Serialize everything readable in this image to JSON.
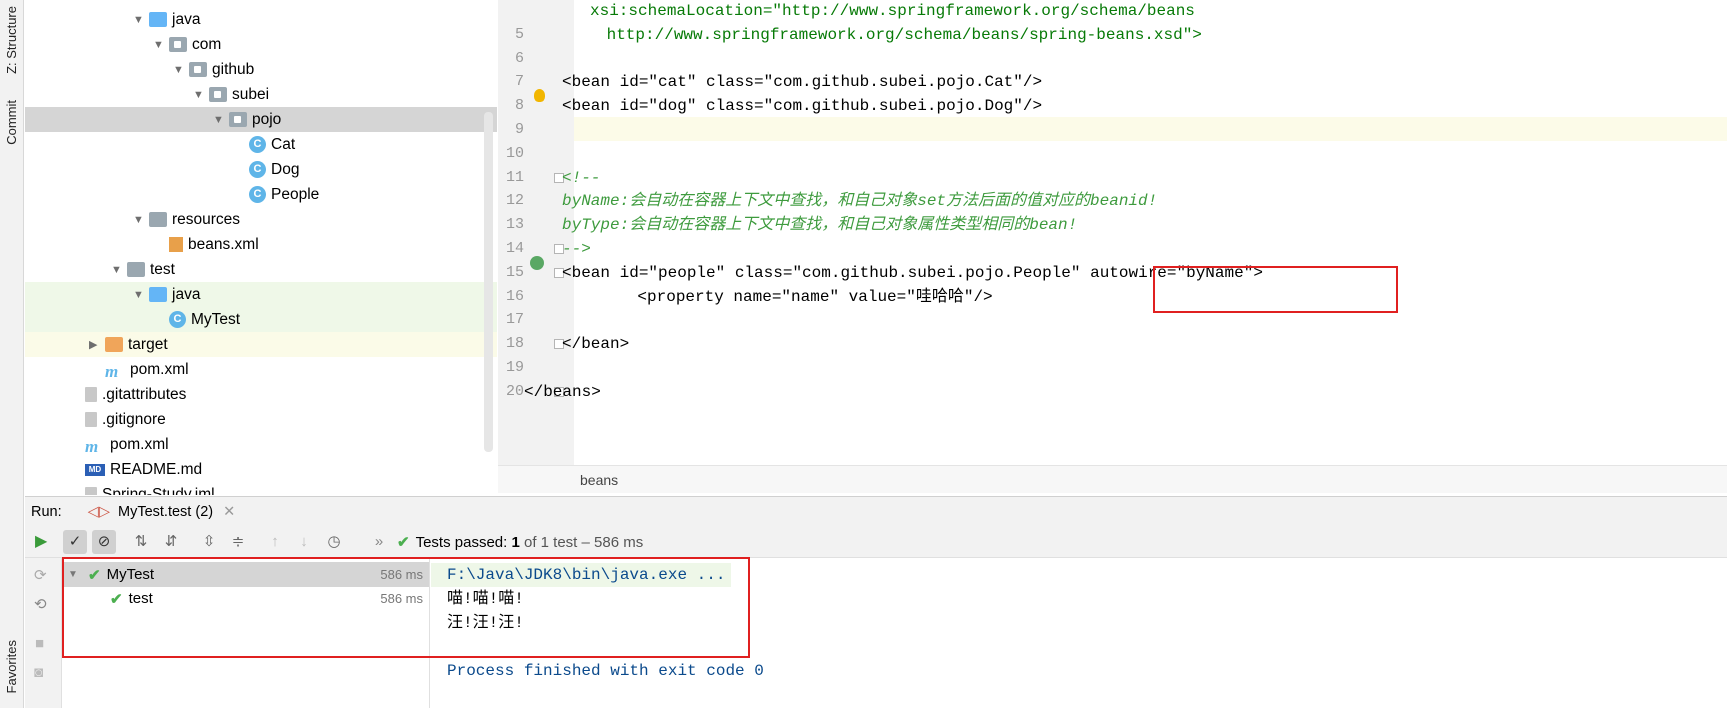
{
  "sidebar_tabs": {
    "structure": "Z: Structure",
    "commit": "Commit",
    "favorites": "Favorites"
  },
  "project_tree": [
    {
      "label": "java",
      "icon": "folder-icon",
      "arrow": "▼"
    },
    {
      "label": "com",
      "icon": "package-icon",
      "arrow": "▼"
    },
    {
      "label": "github",
      "icon": "package-icon",
      "arrow": "▼"
    },
    {
      "label": "subei",
      "icon": "package-icon",
      "arrow": "▼"
    },
    {
      "label": "pojo",
      "icon": "package-icon",
      "arrow": "▼"
    },
    {
      "label": "Cat",
      "icon": "class-icon",
      "arrow": ""
    },
    {
      "label": "Dog",
      "icon": "class-icon",
      "arrow": ""
    },
    {
      "label": "People",
      "icon": "class-icon",
      "arrow": ""
    },
    {
      "label": "resources",
      "icon": "resources-folder-icon",
      "arrow": "▼"
    },
    {
      "label": "beans.xml",
      "icon": "xml-file-icon",
      "arrow": ""
    },
    {
      "label": "test",
      "icon": "folder-icon",
      "arrow": "▼"
    },
    {
      "label": "java",
      "icon": "test-folder-icon",
      "arrow": "▼"
    },
    {
      "label": "MyTest",
      "icon": "test-class-icon",
      "arrow": ""
    },
    {
      "label": "target",
      "icon": "excluded-folder-icon",
      "arrow": "▶"
    },
    {
      "label": "pom.xml",
      "icon": "maven-icon",
      "arrow": ""
    },
    {
      "label": ".gitattributes",
      "icon": "file-icon",
      "arrow": ""
    },
    {
      "label": ".gitignore",
      "icon": "file-icon",
      "arrow": ""
    },
    {
      "label": "pom.xml",
      "icon": "maven-icon",
      "arrow": ""
    },
    {
      "label": "README.md",
      "icon": "markdown-icon",
      "arrow": ""
    },
    {
      "label": "Spring-Study.iml",
      "icon": "file-icon",
      "arrow": ""
    }
  ],
  "editor": {
    "lines": [
      {
        "n": "",
        "text": "xsi:schemaLocation=\"http://www.springframework.org/schema/beans"
      },
      {
        "n": "5",
        "text": " http://www.springframework.org/schema/beans/spring-beans.xsd\">"
      },
      {
        "n": "6",
        "text": ""
      },
      {
        "n": "7",
        "text": "<bean id=\"cat\" class=\"com.github.subei.pojo.Cat\"/>"
      },
      {
        "n": "8",
        "text": "<bean id=\"dog\" class=\"com.github.subei.pojo.Dog\"/>"
      },
      {
        "n": "9",
        "text": ""
      },
      {
        "n": "10",
        "text": ""
      },
      {
        "n": "11",
        "text": "<!--"
      },
      {
        "n": "12",
        "text": "byName:会自动在容器上下文中查找，和自己对象set方法后面的值对应的beanid!"
      },
      {
        "n": "13",
        "text": "byType:会自动在容器上下文中查找，和自己对象属性类型相同的bean!"
      },
      {
        "n": "14",
        "text": "-->"
      },
      {
        "n": "15",
        "text": "<bean id=\"people\" class=\"com.github.subei.pojo.People\" autowire=\"byName\">"
      },
      {
        "n": "16",
        "text": "    <property name=\"name\" value=\"哇哈哈\"/>"
      },
      {
        "n": "17",
        "text": ""
      },
      {
        "n": "18",
        "text": "</bean>"
      },
      {
        "n": "19",
        "text": ""
      },
      {
        "n": "20",
        "text": "</beans>"
      }
    ],
    "breadcrumb": "beans"
  },
  "run": {
    "label": "Run:",
    "tab": "MyTest.test (2)",
    "status_prefix": "Tests passed:",
    "status_count": "1",
    "status_suffix": "of 1 test – 586 ms",
    "tests": [
      {
        "name": "MyTest",
        "duration": "586 ms"
      },
      {
        "name": "test",
        "duration": "586 ms"
      }
    ],
    "console": [
      "F:\\Java\\JDK8\\bin\\java.exe ...",
      "喵!喵!喵!",
      "汪!汪!汪!",
      "",
      "Process finished with exit code 0"
    ]
  }
}
